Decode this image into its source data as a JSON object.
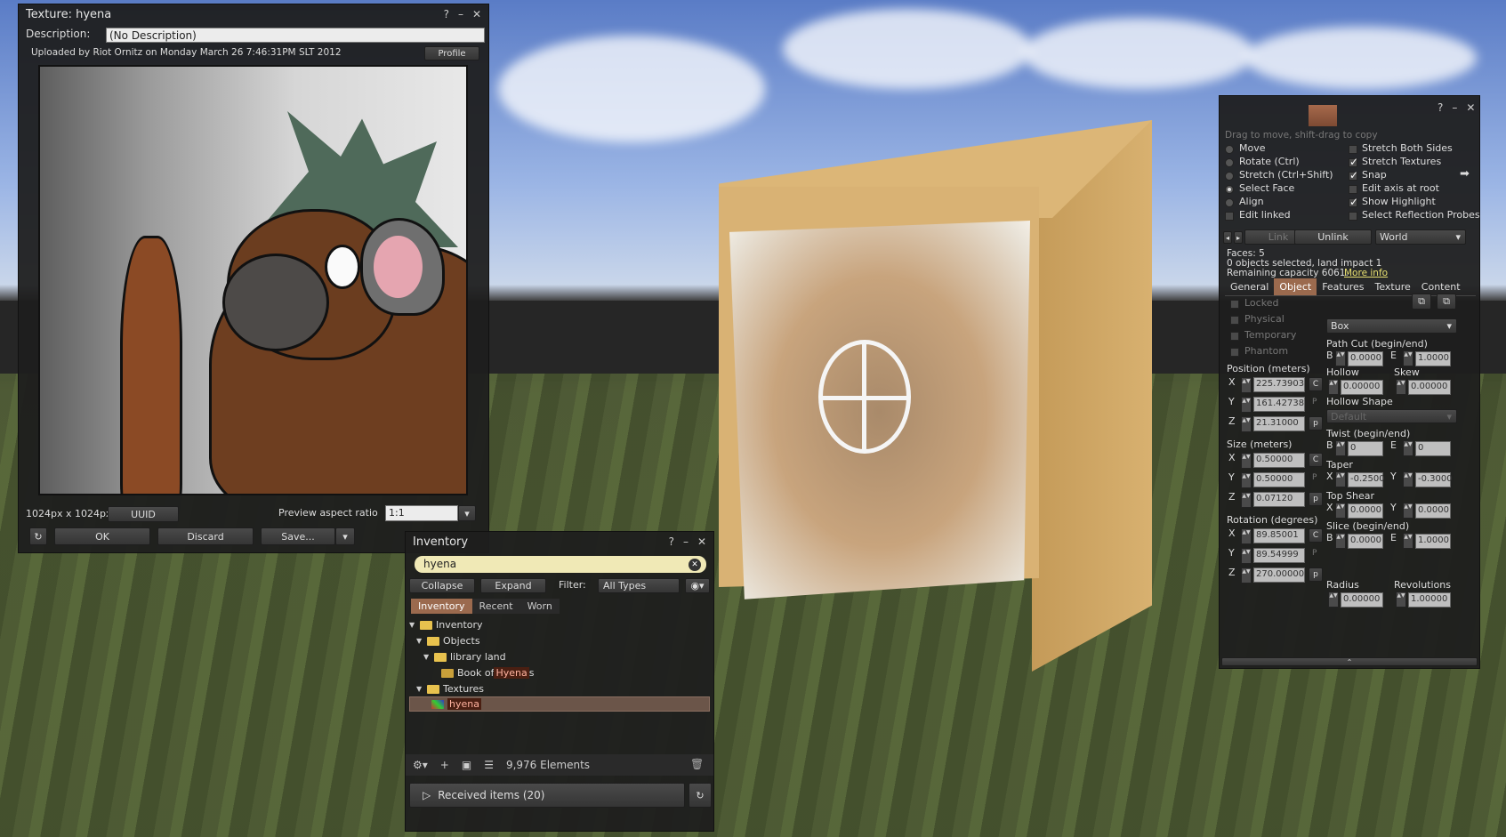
{
  "texture": {
    "title": "Texture: hyena",
    "description_label": "Description:",
    "description_value": "(No Description)",
    "uploaded": "Uploaded by Riot Ornitz on Monday March 26 7:46:31PM SLT 2012",
    "profile_btn": "Profile",
    "dimensions": "1024px x 1024px",
    "uuid_btn": "UUID",
    "aspect_label": "Preview aspect ratio",
    "aspect_value": "1:1",
    "ok_btn": "OK",
    "discard_btn": "Discard",
    "save_btn": "Save..."
  },
  "inventory": {
    "title": "Inventory",
    "search_value": "hyena",
    "collapse_btn": "Collapse",
    "expand_btn": "Expand",
    "filter_label": "Filter:",
    "filter_value": "All Types",
    "tabs": [
      "Inventory",
      "Recent",
      "Worn"
    ],
    "tree": {
      "root": "Inventory",
      "objects": "Objects",
      "library_land": "library land",
      "book_pre": "Book of ",
      "book_hl": "Hyena",
      "book_post": "s",
      "textures": "Textures",
      "hyena": "hyena"
    },
    "count": "9,976 Elements",
    "received": "Received items (20)"
  },
  "build": {
    "hint": "Drag to move, shift-drag to copy",
    "modes": [
      "Move",
      "Rotate (Ctrl)",
      "Stretch (Ctrl+Shift)",
      "Select Face",
      "Align"
    ],
    "edit_linked": "Edit linked",
    "options": [
      "Stretch Both Sides",
      "Stretch Textures",
      "Snap",
      "Edit axis at root",
      "Show Highlight",
      "Select Reflection Probes"
    ],
    "link_btn": "Link",
    "unlink_btn": "Unlink",
    "world_value": "World",
    "faces": "Faces: 5",
    "selected": "0 objects selected, land impact 1",
    "capacity": "Remaining capacity 6061.",
    "more_info": "More info",
    "tabs": [
      "General",
      "Object",
      "Features",
      "Texture",
      "Content"
    ],
    "flags": [
      "Locked",
      "Physical",
      "Temporary",
      "Phantom"
    ],
    "shape_value": "Box",
    "path_cut_label": "Path Cut (begin/end)",
    "path_cut_b": "0.0000",
    "path_cut_e": "1.0000",
    "hollow_label": "Hollow",
    "hollow_value": "0.00000",
    "skew_label": "Skew",
    "skew_value": "0.00000",
    "hollow_shape_label": "Hollow Shape",
    "hollow_shape_value": "Default",
    "twist_label": "Twist (begin/end)",
    "twist_b": "0",
    "twist_e": "0",
    "taper_label": "Taper",
    "taper_x": "-0.2500",
    "taper_y": "-0.3000",
    "top_shear_label": "Top Shear",
    "top_shear_x": "0.0000",
    "top_shear_y": "0.0000",
    "slice_label": "Slice (begin/end)",
    "slice_b": "0.0000",
    "slice_e": "1.0000",
    "radius_label": "Radius",
    "radius_value": "0.00000",
    "revolutions_label": "Revolutions",
    "revolutions_value": "1.00000",
    "position_label": "Position (meters)",
    "pos_x": "225.73903",
    "pos_y": "161.42738",
    "pos_z": "21.31000",
    "size_label": "Size (meters)",
    "size_x": "0.50000",
    "size_y": "0.50000",
    "size_z": "0.07120",
    "rotation_label": "Rotation (degrees)",
    "rot_x": "89.85001",
    "rot_y": "89.54999",
    "rot_z": "270.00000"
  },
  "colors": {
    "accent": "#9b6a4e",
    "panel": "#1e1e1e",
    "link": "#e8e070"
  }
}
